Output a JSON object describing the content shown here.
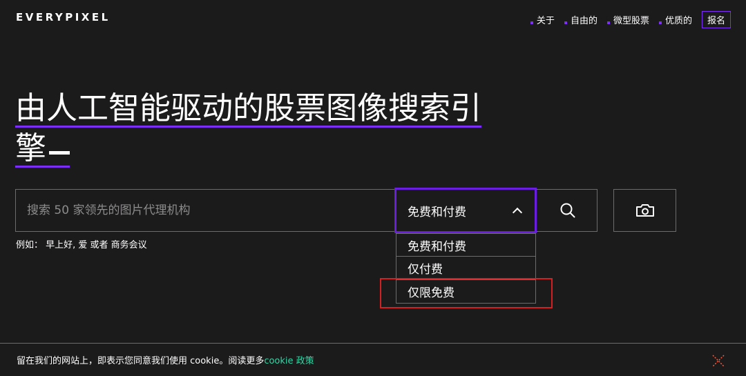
{
  "brand": {
    "logo": "EVERYPIXEL",
    "accent": "#7b2ff7"
  },
  "nav": {
    "items": [
      "关于",
      "自由的",
      "微型股票",
      "优质的"
    ],
    "signup": "报名"
  },
  "hero": {
    "line1": "由人工智能驱动的股票图像搜索引",
    "line2": "擎"
  },
  "search": {
    "placeholder": "搜索 50 家领先的图片代理机构",
    "value": "",
    "filter_selected": "免费和付费",
    "filter_options": [
      "免费和付费",
      "仅付费",
      "仅限免费"
    ],
    "examples": "例如：  早上好, 爱 或者 商务会议"
  },
  "cookie": {
    "text": "留在我们的网站上，即表示您同意我们使用 cookie。阅读更多",
    "link": "cookie 政策"
  },
  "icons": {
    "search": "search-icon",
    "camera": "camera-icon",
    "close": "close-icon",
    "chevron": "chevron-up-icon"
  }
}
